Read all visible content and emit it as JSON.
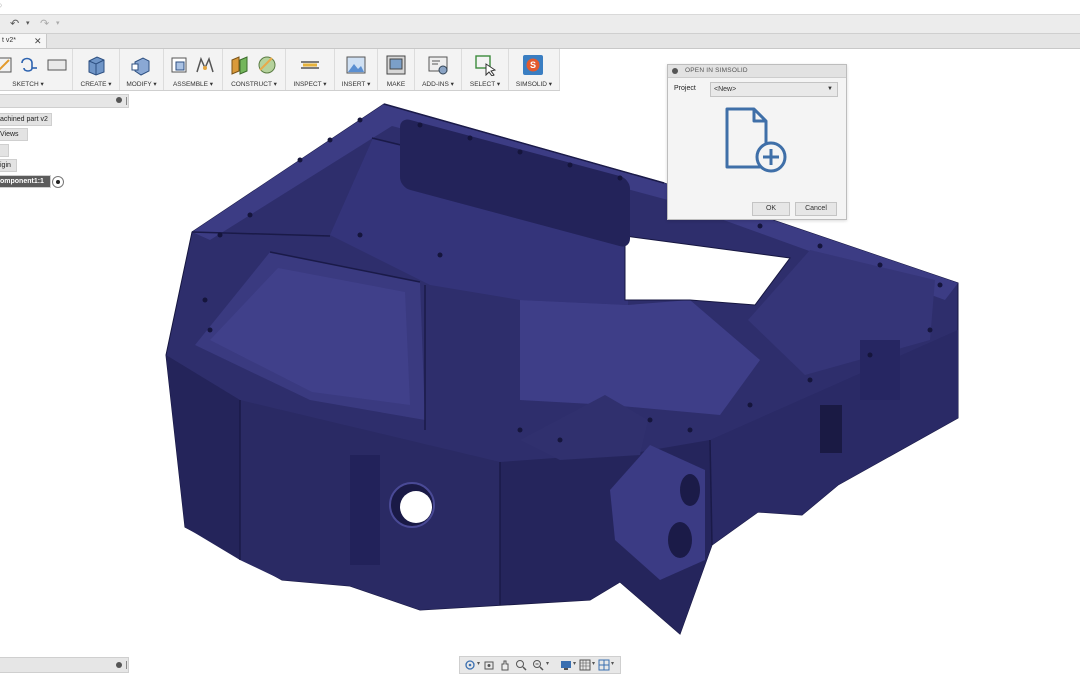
{
  "quickbar": {
    "undo": "↶",
    "redo": "↷"
  },
  "document_tab": {
    "title": "t v2*",
    "close": "✕"
  },
  "toolbar": {
    "groups": [
      {
        "label": "SKETCH ▾"
      },
      {
        "label": "CREATE ▾"
      },
      {
        "label": "MODIFY ▾"
      },
      {
        "label": "ASSEMBLE ▾"
      },
      {
        "label": "CONSTRUCT ▾"
      },
      {
        "label": "INSPECT ▾"
      },
      {
        "label": "INSERT ▾"
      },
      {
        "label": "MAKE"
      },
      {
        "label": "ADD-INS ▾"
      },
      {
        "label": "SELECT ▾"
      },
      {
        "label": "SIMSOLID ▾"
      }
    ]
  },
  "browser": {
    "nodes": [
      {
        "label": "achined part v2"
      },
      {
        "label": "Views"
      },
      {
        "label": ""
      },
      {
        "label": "igin"
      },
      {
        "label": "omponent1:1"
      }
    ]
  },
  "dialog": {
    "title": "OPEN IN SIMSOLID",
    "project_label": "Project",
    "project_value": "<New>",
    "ok": "OK",
    "cancel": "Cancel"
  },
  "colors": {
    "part_fill": "#2e2e6c",
    "part_dark": "#1d1d4c",
    "part_light": "#3d3d86",
    "viewport_bg": "#ffffff",
    "icon_blue": "#3f6fa8"
  }
}
